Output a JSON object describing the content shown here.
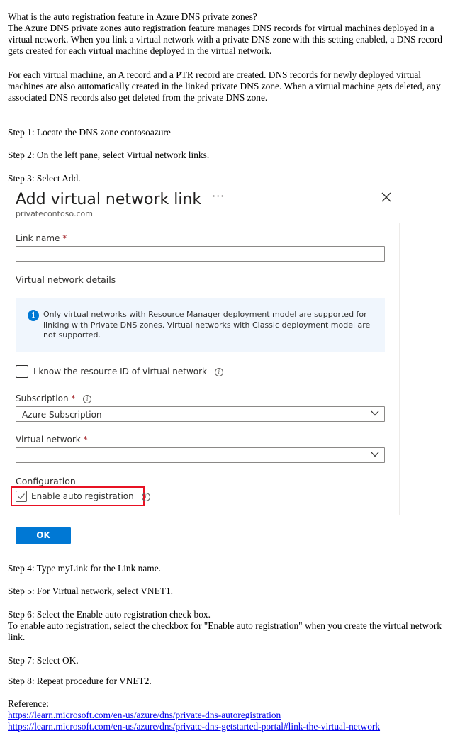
{
  "intro": {
    "question": "What is the auto registration feature in Azure DNS private zones?",
    "para1": "The Azure DNS private zones auto registration feature manages DNS records for virtual machines deployed in a virtual network. When you link a virtual network with a private DNS zone with this setting enabled, a DNS record gets created for each virtual machine deployed in the virtual network.",
    "para2": "For each virtual machine, an A record and a PTR record are created. DNS records for newly deployed virtual machines are also automatically created in the linked private DNS zone. When a virtual machine gets deleted, any associated DNS records also get deleted from the private DNS zone."
  },
  "steps_before": {
    "step1": "Step 1: Locate the DNS zone contosoazure",
    "step2": "Step 2: On the left pane, select Virtual network links.",
    "step3": "Step 3: Select Add."
  },
  "panel": {
    "title": "Add virtual network link",
    "more": "···",
    "subtitle": "privatecontoso.com",
    "link_name_label": "Link name",
    "required_mark": "*",
    "link_name_value": "",
    "vnet_details_heading": "Virtual network details",
    "info_icon": "i",
    "info_text": "Only virtual networks with Resource Manager deployment model are supported for linking with Private DNS zones. Virtual networks with Classic deployment model are not supported.",
    "know_id_label": "I know the resource ID of virtual network",
    "subscription_label": "Subscription",
    "subscription_value": "Azure Subscription",
    "virtual_network_label": "Virtual network",
    "virtual_network_value": "",
    "configuration_heading": "Configuration",
    "auto_registration_label": "Enable auto registration",
    "auto_registration_checked": true,
    "ok_label": "OK",
    "colors": {
      "accent": "#0078d4",
      "highlight": "#e81123",
      "info_bg": "#f0f6fd"
    }
  },
  "steps_after": {
    "step4": "Step 4: Type myLink for the Link name.",
    "step5": "Step 5: For Virtual network, select VNET1.",
    "step6": "Step 6: Select the Enable auto registration check box.",
    "step6_detail": "To enable auto registration, select the checkbox for \"Enable auto registration\" when you create the virtual network link.",
    "step7": "Step 7: Select OK.",
    "step8": "Step 8: Repeat procedure for VNET2."
  },
  "reference": {
    "label": "Reference:",
    "links": [
      "https://learn.microsoft.com/en-us/azure/dns/private-dns-autoregistration",
      "https://learn.microsoft.com/en-us/azure/dns/private-dns-getstarted-portal#link-the-virtual-network"
    ]
  }
}
